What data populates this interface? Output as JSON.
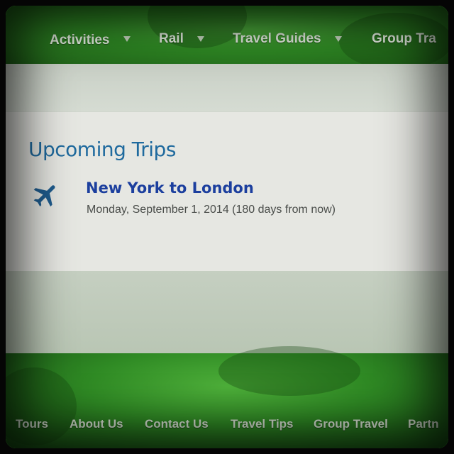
{
  "nav": {
    "items": [
      {
        "label": "Activities"
      },
      {
        "label": "Rail"
      },
      {
        "label": "Travel Guides"
      },
      {
        "label": "Group Tra"
      }
    ]
  },
  "upcoming": {
    "title": "Upcoming Trips",
    "trips": [
      {
        "icon": "airplane-icon",
        "title": "New York to London",
        "date": "Monday, September 1, 2014 (180 days from now)"
      }
    ]
  },
  "footer": {
    "links": [
      {
        "label": "Tours"
      },
      {
        "label": "About Us"
      },
      {
        "label": "Contact Us"
      },
      {
        "label": "Travel Tips"
      },
      {
        "label": "Group Travel"
      },
      {
        "label": "Partn"
      }
    ]
  },
  "colors": {
    "brand_green": "#2f8a24",
    "heading_blue": "#1f6a9e",
    "link_blue": "#1c3f9e"
  }
}
